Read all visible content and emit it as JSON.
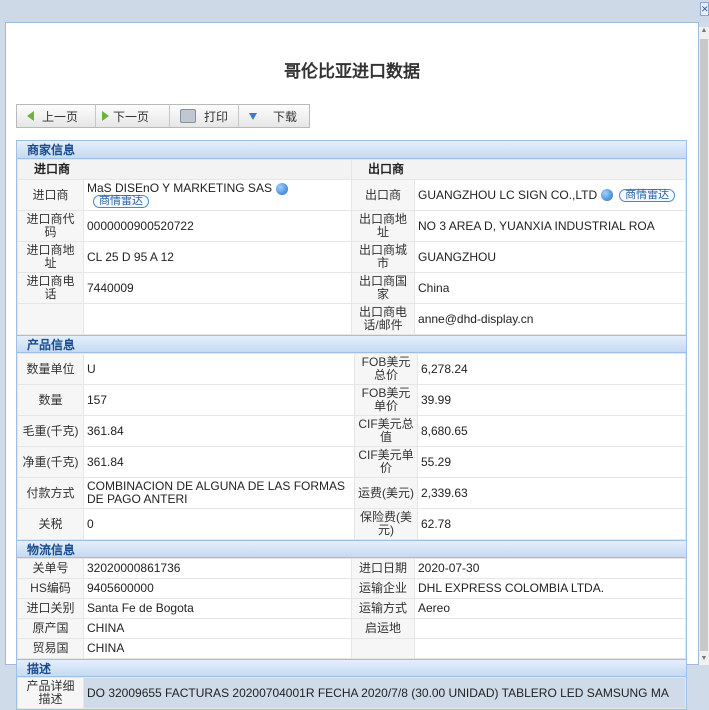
{
  "window": {
    "close_icon": "close-icon"
  },
  "title": "哥伦比亚进口数据",
  "toolbar": {
    "prev": "上一页",
    "next": "下一页",
    "print": "打印",
    "download": "下载"
  },
  "merchant": {
    "header": "商家信息",
    "importer_col": "进口商",
    "exporter_col": "出口商",
    "radar_label": "商情雷达",
    "rows": [
      {
        "l1": "进口商",
        "v1": "MaS DISEnO Y MARKETING SAS",
        "l2": "出口商",
        "v2": "GUANGZHOU LC SIGN CO.,LTD"
      },
      {
        "l1": "进口商代码",
        "v1": "0000000900520722",
        "l2": "出口商地址",
        "v2": "NO 3 AREA D, YUANXIA INDUSTRIAL ROA"
      },
      {
        "l1": "进口商地址",
        "v1": "CL 25 D 95 A 12",
        "l2": "出口商城市",
        "v2": "GUANGZHOU"
      },
      {
        "l1": "进口商电话",
        "v1": "7440009",
        "l2": "出口商国家",
        "v2": "China"
      },
      {
        "l1": "",
        "v1": "",
        "l2": "出口商电话/邮件",
        "v2": "anne@dhd-display.cn"
      }
    ]
  },
  "product": {
    "header": "产品信息",
    "rows": [
      {
        "l1": "数量单位",
        "v1": "U",
        "l2": "FOB美元总价",
        "v2": "6,278.24"
      },
      {
        "l1": "数量",
        "v1": "157",
        "l2": "FOB美元单价",
        "v2": "39.99"
      },
      {
        "l1": "毛重(千克)",
        "v1": "361.84",
        "l2": "CIF美元总值",
        "v2": "8,680.65"
      },
      {
        "l1": "净重(千克)",
        "v1": "361.84",
        "l2": "CIF美元单价",
        "v2": "55.29"
      },
      {
        "l1": "付款方式",
        "v1": "COMBINACION DE ALGUNA DE LAS FORMAS DE PAGO ANTERI",
        "l2": "运费(美元)",
        "v2": "2,339.63"
      },
      {
        "l1": "关税",
        "v1": "0",
        "l2": "保险费(美元)",
        "v2": "62.78"
      }
    ]
  },
  "logistics": {
    "header": "物流信息",
    "rows": [
      {
        "l1": "关单号",
        "v1": "32020000861736",
        "l2": "进口日期",
        "v2": "2020-07-30"
      },
      {
        "l1": "HS编码",
        "v1": "9405600000",
        "l2": "运输企业",
        "v2": "DHL EXPRESS COLOMBIA LTDA."
      },
      {
        "l1": "进口关别",
        "v1": "Santa Fe de Bogota",
        "l2": "运输方式",
        "v2": "Aereo"
      },
      {
        "l1": "原产国",
        "v1": "CHINA",
        "l2": "启运地",
        "v2": ""
      },
      {
        "l1": "贸易国",
        "v1": "CHINA",
        "l2": "",
        "v2": ""
      }
    ]
  },
  "description": {
    "header": "描述",
    "label": "产品详细描述",
    "value": "DO 32009655 FACTURAS 20200704001R FECHA 2020/7/8 (30.00 UNIDAD) TABLERO LED SAMSUNG MA"
  }
}
